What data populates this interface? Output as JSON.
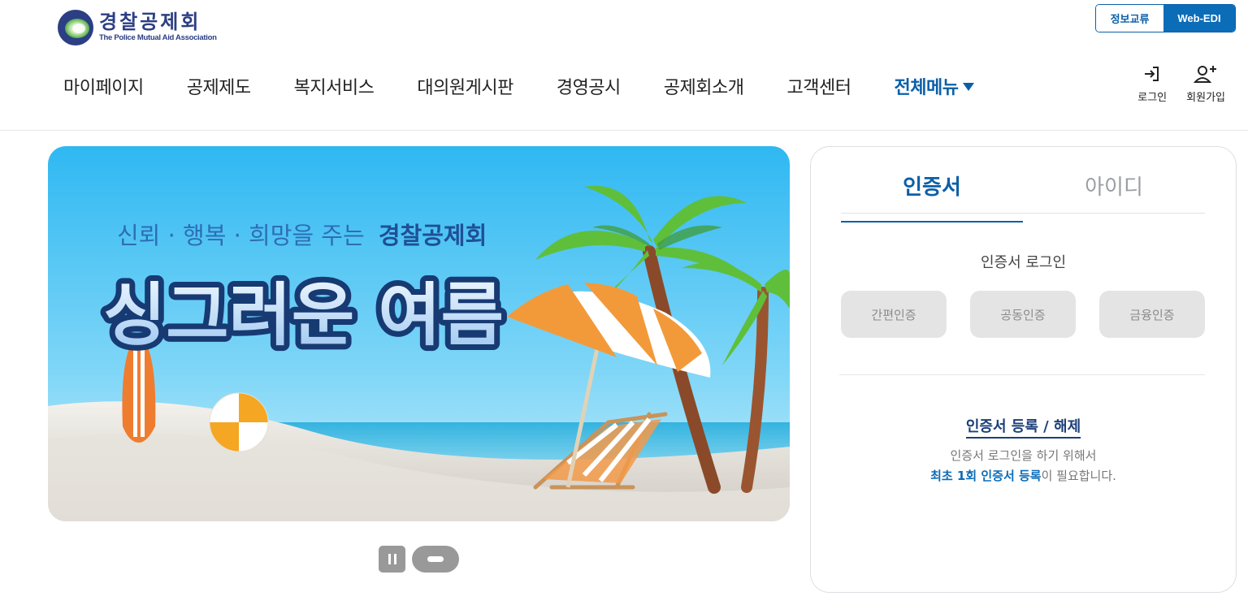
{
  "header": {
    "logo_ko": "경찰공제회",
    "logo_en": "The Police Mutual Aid Association",
    "utility": [
      "정보교류",
      "Web-EDI"
    ],
    "nav": [
      "마이페이지",
      "공제제도",
      "복지서비스",
      "대의원게시판",
      "경영공시",
      "공제회소개",
      "고객센터"
    ],
    "nav_all": "전체메뉴",
    "login_label": "로그인",
    "join_label": "회원가입"
  },
  "banner": {
    "subtitle_prefix": "신뢰 · 행복 · 희망을 주는",
    "subtitle_brand": "경찰공제회",
    "headline": "싱그러운 여름"
  },
  "login_panel": {
    "tabs": [
      "인증서",
      "아이디"
    ],
    "cert_title": "인증서 로그인",
    "cert_buttons": [
      "간편인증",
      "공동인증",
      "금융인증"
    ],
    "register_link": "인증서 등록 / 해제",
    "desc_line1": "인증서 로그인을 하기 위해서",
    "desc_line2_highlight": "최초 1회 인증서 등록",
    "desc_line2_rest": "이 필요합니다."
  },
  "colors": {
    "brand_blue": "#0b5fa8",
    "logo_navy": "#2c3e84",
    "button_gray": "#e4e4e4"
  },
  "icons": [
    "login-icon",
    "user-add-icon",
    "caret-down-icon",
    "pause-icon"
  ]
}
